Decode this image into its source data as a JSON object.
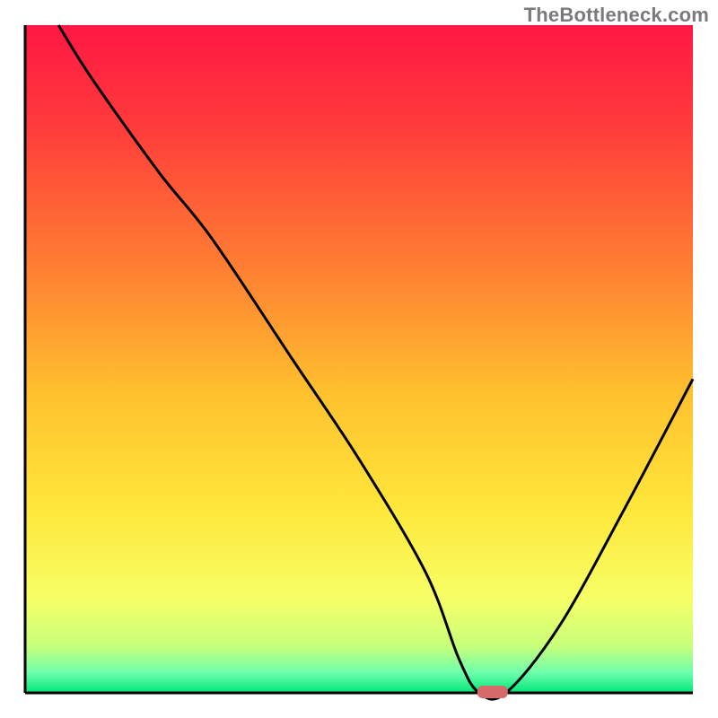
{
  "watermark": "TheBottleneck.com",
  "chart_data": {
    "type": "line",
    "title": "",
    "xlabel": "",
    "ylabel": "",
    "xlim": [
      0,
      100
    ],
    "ylim": [
      0,
      100
    ],
    "x": [
      5,
      10,
      20,
      28,
      40,
      50,
      60,
      65,
      68,
      72,
      80,
      90,
      100
    ],
    "values": [
      100,
      92,
      78,
      68,
      50,
      35,
      18,
      5,
      0,
      0,
      10,
      28,
      47
    ],
    "marker": {
      "x": 70,
      "y": 0
    },
    "gradient_stops": [
      {
        "offset": 0.0,
        "color": "#ff1744"
      },
      {
        "offset": 0.15,
        "color": "#ff3b3b"
      },
      {
        "offset": 0.35,
        "color": "#ff7a33"
      },
      {
        "offset": 0.55,
        "color": "#ffc02e"
      },
      {
        "offset": 0.72,
        "color": "#ffe63a"
      },
      {
        "offset": 0.86,
        "color": "#f6ff66"
      },
      {
        "offset": 0.93,
        "color": "#c7ff7a"
      },
      {
        "offset": 0.97,
        "color": "#6dffad"
      },
      {
        "offset": 1.0,
        "color": "#00e676"
      }
    ],
    "curve_color": "#000000",
    "marker_color": "#d46a6a",
    "axis_color": "#000000"
  }
}
